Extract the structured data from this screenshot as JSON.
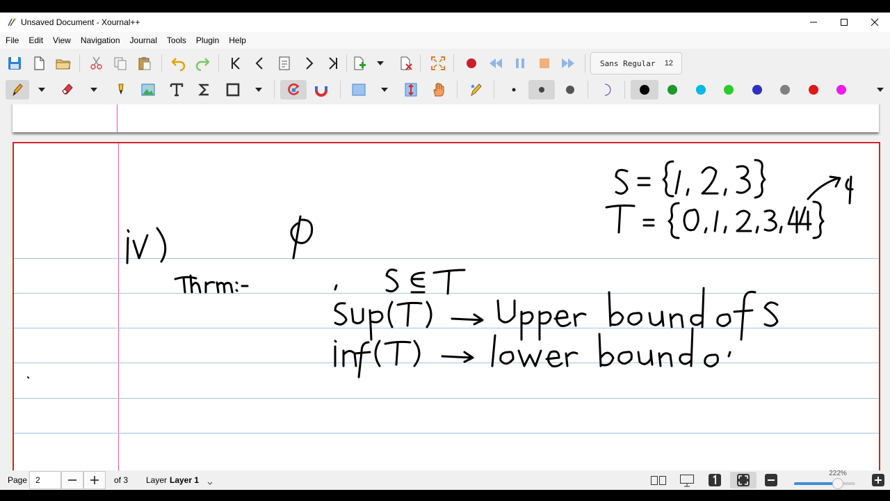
{
  "window": {
    "title": "Unsaved Document - Xournal++"
  },
  "menu": [
    "File",
    "Edit",
    "View",
    "Navigation",
    "Journal",
    "Tools",
    "Plugin",
    "Help"
  ],
  "toolbar": {
    "font_name": "Sans Regular",
    "font_size": "12",
    "pen_colors": [
      "#000000",
      "#1a9a2a",
      "#00b7e6",
      "#28cc28",
      "#3030c0",
      "#808080",
      "#e01818",
      "#e81ee8"
    ],
    "selected_color": "#000000",
    "accent": "#3d8fd6"
  },
  "statusbar": {
    "page_label": "Page",
    "page_value": "2",
    "of_pages": "of 3",
    "layer_label": "Layer",
    "layer_value": "Layer 1",
    "zoom_text": "222%",
    "zoom_fraction": 0.72
  }
}
